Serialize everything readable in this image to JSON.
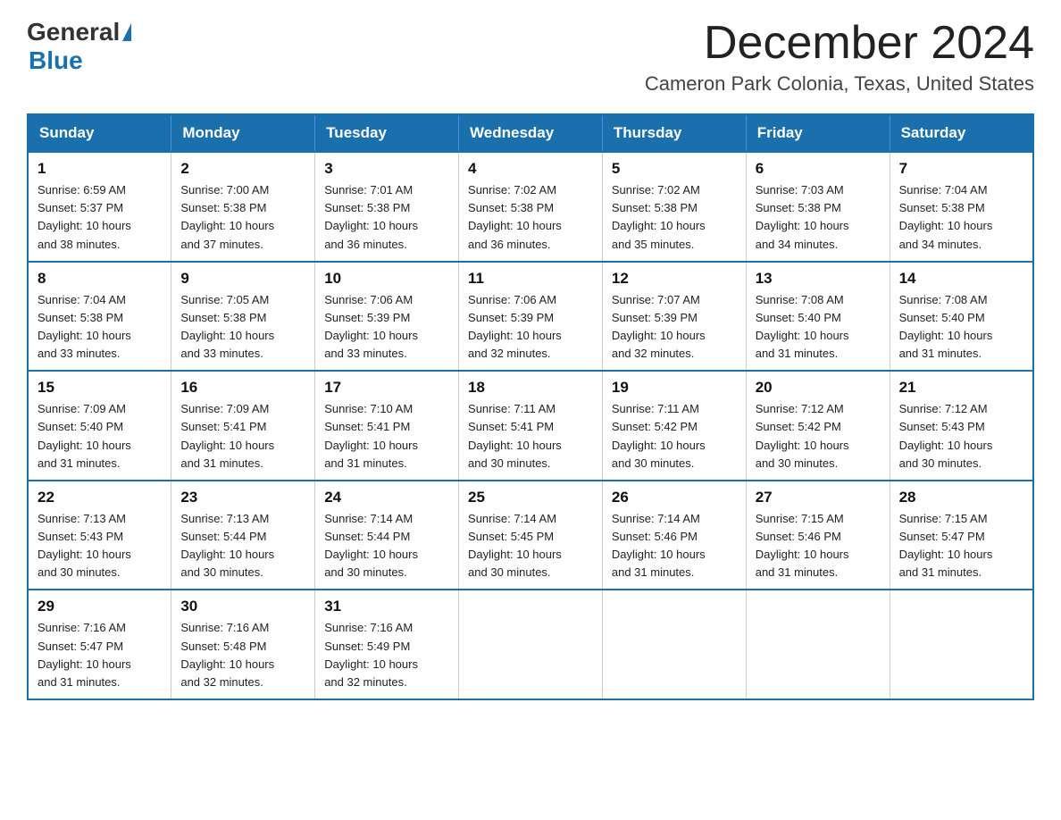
{
  "header": {
    "logo_general": "General",
    "logo_blue": "Blue",
    "month_title": "December 2024",
    "location": "Cameron Park Colonia, Texas, United States"
  },
  "days_of_week": [
    "Sunday",
    "Monday",
    "Tuesday",
    "Wednesday",
    "Thursday",
    "Friday",
    "Saturday"
  ],
  "weeks": [
    [
      {
        "day": "1",
        "sunrise": "6:59 AM",
        "sunset": "5:37 PM",
        "daylight": "10 hours and 38 minutes."
      },
      {
        "day": "2",
        "sunrise": "7:00 AM",
        "sunset": "5:38 PM",
        "daylight": "10 hours and 37 minutes."
      },
      {
        "day": "3",
        "sunrise": "7:01 AM",
        "sunset": "5:38 PM",
        "daylight": "10 hours and 36 minutes."
      },
      {
        "day": "4",
        "sunrise": "7:02 AM",
        "sunset": "5:38 PM",
        "daylight": "10 hours and 36 minutes."
      },
      {
        "day": "5",
        "sunrise": "7:02 AM",
        "sunset": "5:38 PM",
        "daylight": "10 hours and 35 minutes."
      },
      {
        "day": "6",
        "sunrise": "7:03 AM",
        "sunset": "5:38 PM",
        "daylight": "10 hours and 34 minutes."
      },
      {
        "day": "7",
        "sunrise": "7:04 AM",
        "sunset": "5:38 PM",
        "daylight": "10 hours and 34 minutes."
      }
    ],
    [
      {
        "day": "8",
        "sunrise": "7:04 AM",
        "sunset": "5:38 PM",
        "daylight": "10 hours and 33 minutes."
      },
      {
        "day": "9",
        "sunrise": "7:05 AM",
        "sunset": "5:38 PM",
        "daylight": "10 hours and 33 minutes."
      },
      {
        "day": "10",
        "sunrise": "7:06 AM",
        "sunset": "5:39 PM",
        "daylight": "10 hours and 33 minutes."
      },
      {
        "day": "11",
        "sunrise": "7:06 AM",
        "sunset": "5:39 PM",
        "daylight": "10 hours and 32 minutes."
      },
      {
        "day": "12",
        "sunrise": "7:07 AM",
        "sunset": "5:39 PM",
        "daylight": "10 hours and 32 minutes."
      },
      {
        "day": "13",
        "sunrise": "7:08 AM",
        "sunset": "5:40 PM",
        "daylight": "10 hours and 31 minutes."
      },
      {
        "day": "14",
        "sunrise": "7:08 AM",
        "sunset": "5:40 PM",
        "daylight": "10 hours and 31 minutes."
      }
    ],
    [
      {
        "day": "15",
        "sunrise": "7:09 AM",
        "sunset": "5:40 PM",
        "daylight": "10 hours and 31 minutes."
      },
      {
        "day": "16",
        "sunrise": "7:09 AM",
        "sunset": "5:41 PM",
        "daylight": "10 hours and 31 minutes."
      },
      {
        "day": "17",
        "sunrise": "7:10 AM",
        "sunset": "5:41 PM",
        "daylight": "10 hours and 31 minutes."
      },
      {
        "day": "18",
        "sunrise": "7:11 AM",
        "sunset": "5:41 PM",
        "daylight": "10 hours and 30 minutes."
      },
      {
        "day": "19",
        "sunrise": "7:11 AM",
        "sunset": "5:42 PM",
        "daylight": "10 hours and 30 minutes."
      },
      {
        "day": "20",
        "sunrise": "7:12 AM",
        "sunset": "5:42 PM",
        "daylight": "10 hours and 30 minutes."
      },
      {
        "day": "21",
        "sunrise": "7:12 AM",
        "sunset": "5:43 PM",
        "daylight": "10 hours and 30 minutes."
      }
    ],
    [
      {
        "day": "22",
        "sunrise": "7:13 AM",
        "sunset": "5:43 PM",
        "daylight": "10 hours and 30 minutes."
      },
      {
        "day": "23",
        "sunrise": "7:13 AM",
        "sunset": "5:44 PM",
        "daylight": "10 hours and 30 minutes."
      },
      {
        "day": "24",
        "sunrise": "7:14 AM",
        "sunset": "5:44 PM",
        "daylight": "10 hours and 30 minutes."
      },
      {
        "day": "25",
        "sunrise": "7:14 AM",
        "sunset": "5:45 PM",
        "daylight": "10 hours and 30 minutes."
      },
      {
        "day": "26",
        "sunrise": "7:14 AM",
        "sunset": "5:46 PM",
        "daylight": "10 hours and 31 minutes."
      },
      {
        "day": "27",
        "sunrise": "7:15 AM",
        "sunset": "5:46 PM",
        "daylight": "10 hours and 31 minutes."
      },
      {
        "day": "28",
        "sunrise": "7:15 AM",
        "sunset": "5:47 PM",
        "daylight": "10 hours and 31 minutes."
      }
    ],
    [
      {
        "day": "29",
        "sunrise": "7:16 AM",
        "sunset": "5:47 PM",
        "daylight": "10 hours and 31 minutes."
      },
      {
        "day": "30",
        "sunrise": "7:16 AM",
        "sunset": "5:48 PM",
        "daylight": "10 hours and 32 minutes."
      },
      {
        "day": "31",
        "sunrise": "7:16 AM",
        "sunset": "5:49 PM",
        "daylight": "10 hours and 32 minutes."
      },
      null,
      null,
      null,
      null
    ]
  ],
  "labels": {
    "sunrise": "Sunrise:",
    "sunset": "Sunset:",
    "daylight": "Daylight:"
  }
}
